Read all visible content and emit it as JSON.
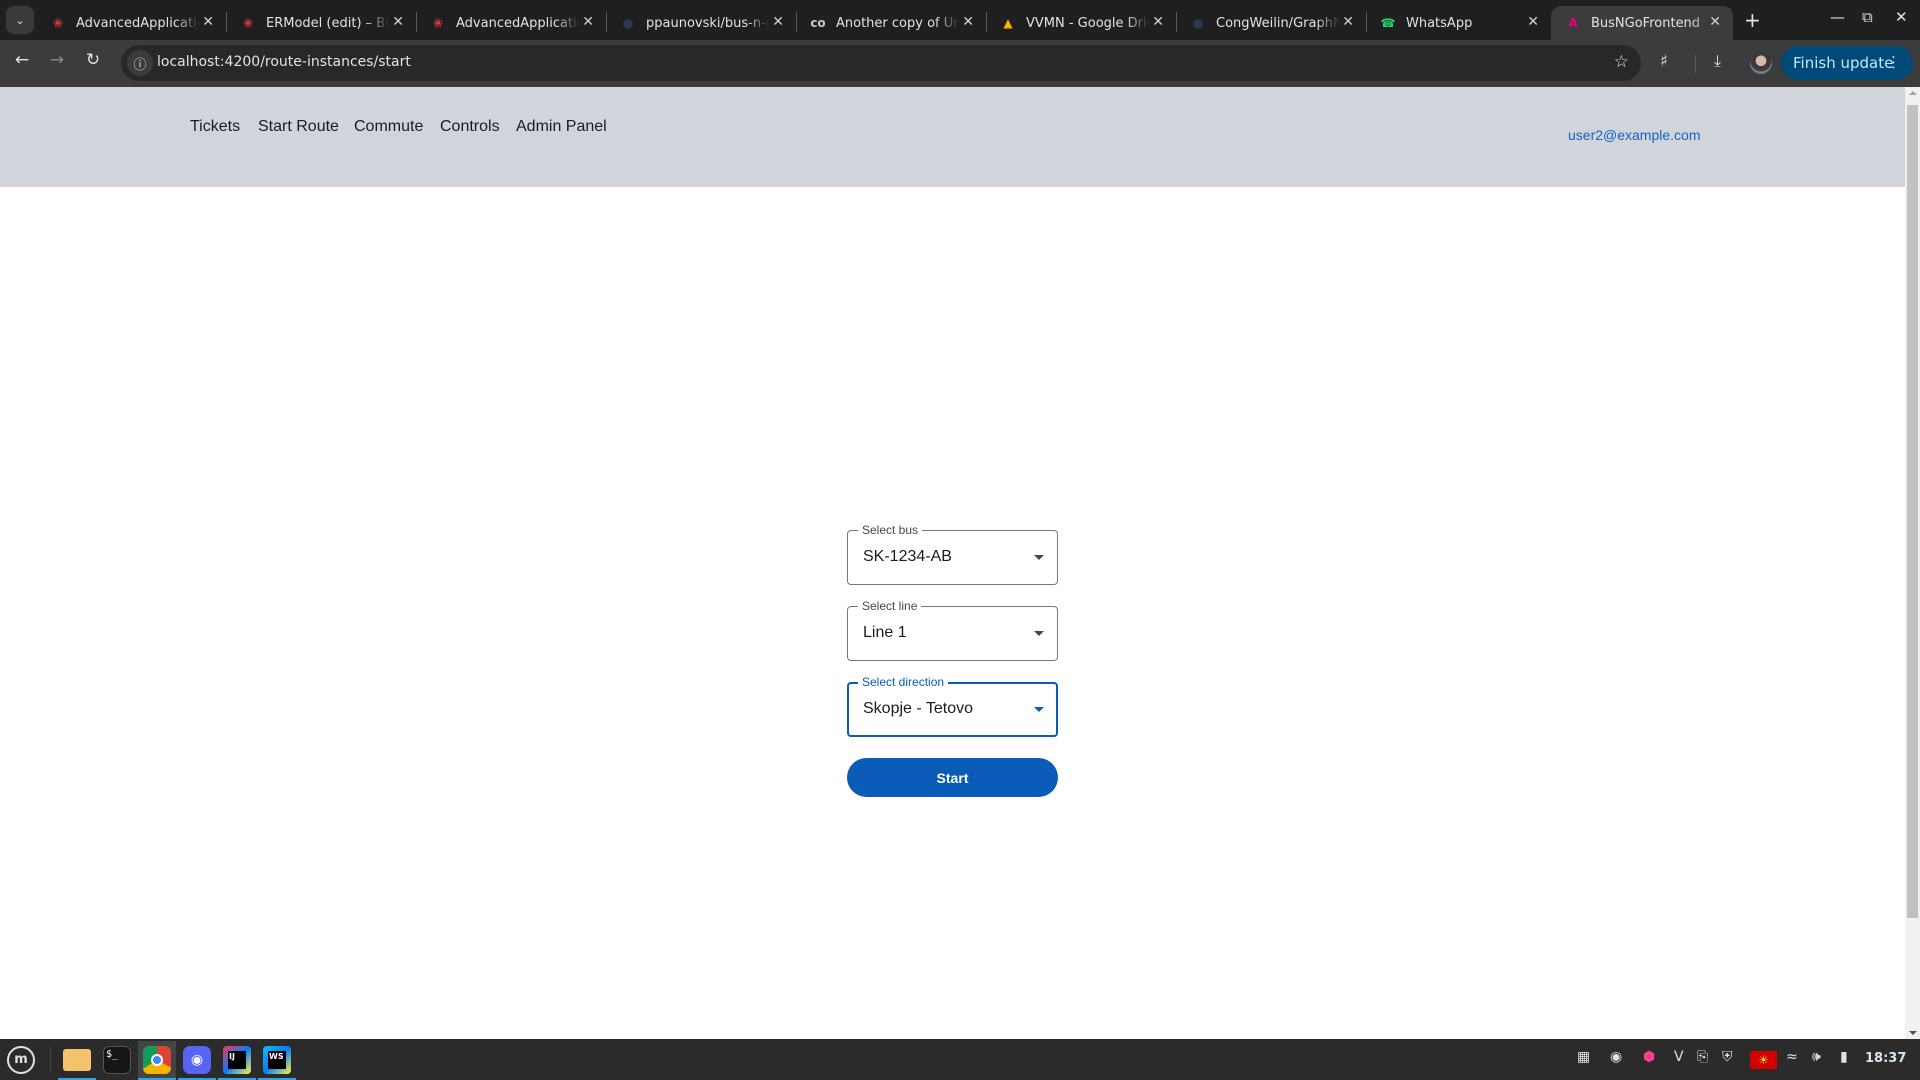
{
  "browser": {
    "tabs": [
      {
        "title": "AdvancedApplicatio",
        "icon": "red-paw-icon",
        "active": false
      },
      {
        "title": "ERModel (edit) – Bu",
        "icon": "red-paw-icon",
        "active": false
      },
      {
        "title": "AdvancedApplicatio",
        "icon": "red-paw-icon",
        "active": false
      },
      {
        "title": "ppaunovski/bus-n-g",
        "icon": "github-icon",
        "active": false
      },
      {
        "title": "Another copy of Unt",
        "icon": "colab-icon",
        "active": false
      },
      {
        "title": "VVMN - Google Driv",
        "icon": "google-drive-icon",
        "active": false
      },
      {
        "title": "CongWeilin/GraphM",
        "icon": "github-icon",
        "active": false
      },
      {
        "title": "WhatsApp",
        "icon": "whatsapp-icon",
        "active": false
      },
      {
        "title": "BusNGoFrontend",
        "icon": "angular-icon",
        "active": true
      }
    ],
    "url": "localhost:4200/route-instances/start",
    "finish_update_label": "Finish update"
  },
  "app": {
    "nav": [
      {
        "label": "Tickets"
      },
      {
        "label": "Start Route"
      },
      {
        "label": "Commute"
      },
      {
        "label": "Controls"
      },
      {
        "label": "Admin Panel"
      }
    ],
    "user_email": "user2@example.com",
    "form": {
      "bus": {
        "label": "Select bus",
        "value": "SK-1234-AB"
      },
      "line": {
        "label": "Select line",
        "value": "Line 1"
      },
      "direction": {
        "label": "Select direction",
        "value": "Skopje - Tetovo"
      },
      "start_label": "Start"
    },
    "colors": {
      "primary": "#0a5cb8",
      "header_bg": "#d1d4db",
      "link": "#1565c0"
    }
  },
  "taskbar": {
    "apps": [
      {
        "name": "files-app-icon",
        "running": true
      },
      {
        "name": "terminal-app-icon",
        "running": false
      },
      {
        "name": "chrome-app-icon",
        "running": true
      },
      {
        "name": "discord-app-icon",
        "running": true
      },
      {
        "name": "intellij-app-icon",
        "running": true
      },
      {
        "name": "webstorm-app-icon",
        "running": true
      }
    ],
    "clock": "18:37"
  }
}
